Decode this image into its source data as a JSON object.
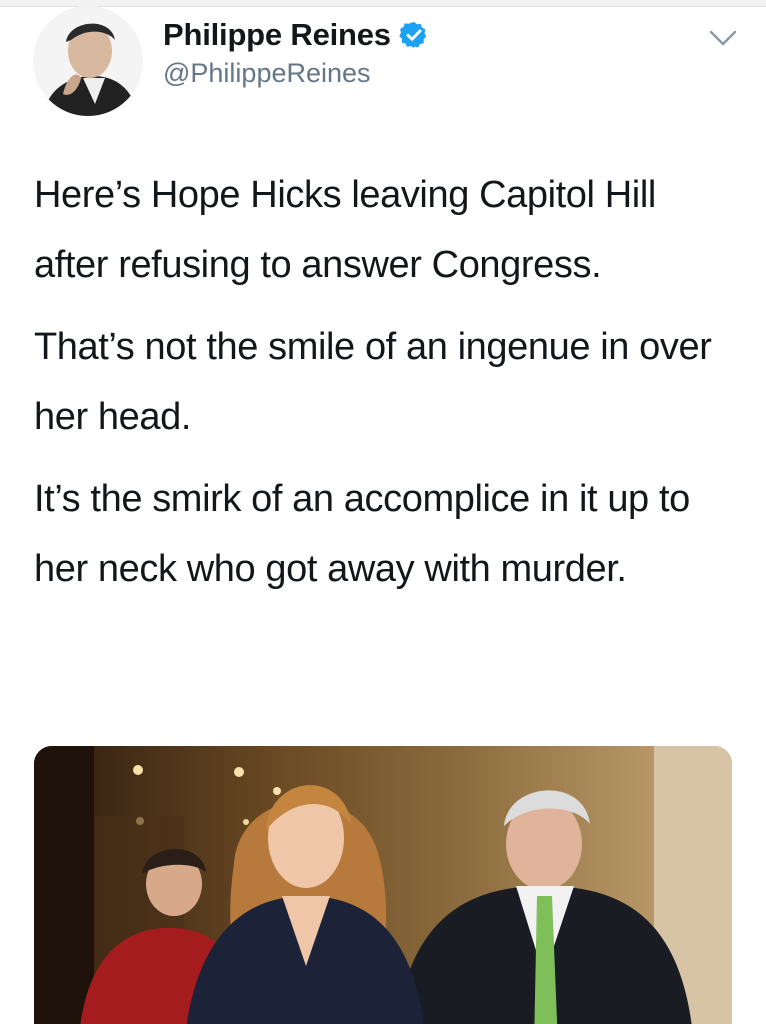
{
  "author": {
    "display_name": "Philippe Reines",
    "handle": "@PhilippeReines",
    "verified": true,
    "avatar": "avatar-photo"
  },
  "icons": {
    "verified": "verified-badge-icon",
    "menu": "chevron-down-icon"
  },
  "colors": {
    "verified_blue": "#1da1f2",
    "text": "#14171a",
    "secondary_text": "#657786"
  },
  "tweet": {
    "paragraphs": [
      "Here’s Hope Hicks leaving Capitol Hill after refusing to answer Congress.",
      "That’s not the smile of an ingenue in over her head.",
      "It’s the smirk of an accomplice in it up to her neck who got away with murder."
    ]
  },
  "media": {
    "type": "photo"
  }
}
